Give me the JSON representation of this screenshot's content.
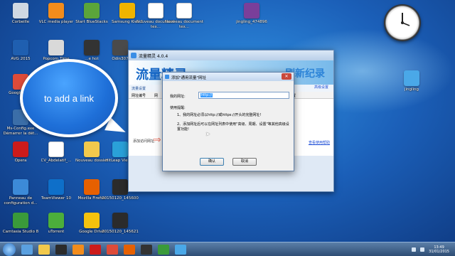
{
  "desktop_icons": [
    {
      "name": "corbeille",
      "label": "Corbeille",
      "icon": "recycle-bin-icon",
      "color": "#cfd8e3"
    },
    {
      "name": "vlc",
      "label": "VLC media player",
      "icon": "vlc-cone-icon",
      "color": "#f28c1c"
    },
    {
      "name": "bluestacks",
      "label": "Start BlueStacks",
      "icon": "bluestacks-icon",
      "color": "#5ba53a"
    },
    {
      "name": "kies",
      "label": "Samsung Kies 3",
      "icon": "kies-icon",
      "color": "#f0b400"
    },
    {
      "name": "nouveau-doc-1",
      "label": "Nouveau document tex...",
      "icon": "text-document-icon",
      "color": "#ffffff"
    },
    {
      "name": "nouveau-doc-2",
      "label": "Nouveau document tex...",
      "icon": "text-document-icon",
      "color": "#ffffff"
    },
    {
      "name": "jingling-zip",
      "label": "jingling_474896",
      "icon": "winrar-icon",
      "color": "#7a3f9a"
    },
    {
      "name": "avg",
      "label": "AVG 2015",
      "icon": "avg-icon",
      "color": "#1f5fb0"
    },
    {
      "name": "popcorn",
      "label": "Popcorn Time",
      "icon": "popcorn-icon",
      "color": "#d9d9d9"
    },
    {
      "name": "odin-hot",
      "label": "...e hot",
      "icon": "odin-icon",
      "color": "#333333"
    },
    {
      "name": "odin",
      "label": "Odin307",
      "icon": "odin-icon",
      "color": "#4a4a4a"
    },
    {
      "name": "chrome",
      "label": "Google Ch...",
      "icon": "chrome-icon",
      "color": "#dd4b39"
    },
    {
      "name": "msconfig",
      "label": "Ms-Config.exe Démarrer la dét...",
      "icon": "msconfig-icon",
      "color": "#3b6ea8"
    },
    {
      "name": "opera",
      "label": "Opera",
      "icon": "opera-icon",
      "color": "#cc1b1b"
    },
    {
      "name": "cv",
      "label": "CV_Abdelatif_...",
      "icon": "text-document-icon",
      "color": "#ffffff"
    },
    {
      "name": "nouveau-dossier",
      "label": "Nouveau dossier",
      "icon": "folder-icon",
      "color": "#f2c94c"
    },
    {
      "name": "hitleap",
      "label": "HitLeap Viewer",
      "icon": "hitleap-icon",
      "color": "#2aa0d8"
    },
    {
      "name": "panneau",
      "label": "Panneau de configuration d...",
      "icon": "control-panel-icon",
      "color": "#3c8ad8"
    },
    {
      "name": "teamviewer",
      "label": "TeamViewer 10",
      "icon": "teamviewer-icon",
      "color": "#0e6fc9"
    },
    {
      "name": "firefox",
      "label": "Mozilla Firefox",
      "icon": "firefox-icon",
      "color": "#e66000"
    },
    {
      "name": "screenshot-1",
      "label": "20150120_145600",
      "icon": "image-file-icon",
      "color": "#2b2b2b"
    },
    {
      "name": "camtasia",
      "label": "Camtasia Studio 8",
      "icon": "camtasia-icon",
      "color": "#3a9a3a"
    },
    {
      "name": "utorrent",
      "label": "uTorrent",
      "icon": "utorrent-icon",
      "color": "#4cae3b"
    },
    {
      "name": "gdrive",
      "label": "Google Drive",
      "icon": "google-drive-icon",
      "color": "#f4c20d"
    },
    {
      "name": "screenshot-2",
      "label": "20150120_145621",
      "icon": "image-file-icon",
      "color": "#2b2b2b"
    },
    {
      "name": "jingling",
      "label": "jingling",
      "icon": "jingling-bird-icon",
      "color": "#4aa8e8"
    }
  ],
  "bubble": {
    "text": "to add a link"
  },
  "app_window": {
    "title": "流量精灵 4.0.4",
    "brand": "流量精灵",
    "slogan": "刷新纪录",
    "tab_label": "流量设置",
    "right_link_top": "高级设置",
    "columns": [
      "网址编号",
      "网",
      "控制",
      "设置"
    ],
    "add_label": "添加访问网址:",
    "right_link_bottom": "查看使用帮助"
  },
  "dialog": {
    "title": "添加\"通用流量\"网址",
    "url_label": "我的网址:",
    "url_value": "http://",
    "tips_title": "使用提醒:",
    "tip1": "1、我的网址必须以http://或https://开头的完整网址!",
    "tip2": "2、添加网址后可以在网址列表中使用\"高级、周期、设置\"等其他高级设置功能!",
    "ok": "确认",
    "cancel": "取消"
  },
  "taskbar": {
    "time": "13:49",
    "date": "31/01/2015"
  }
}
